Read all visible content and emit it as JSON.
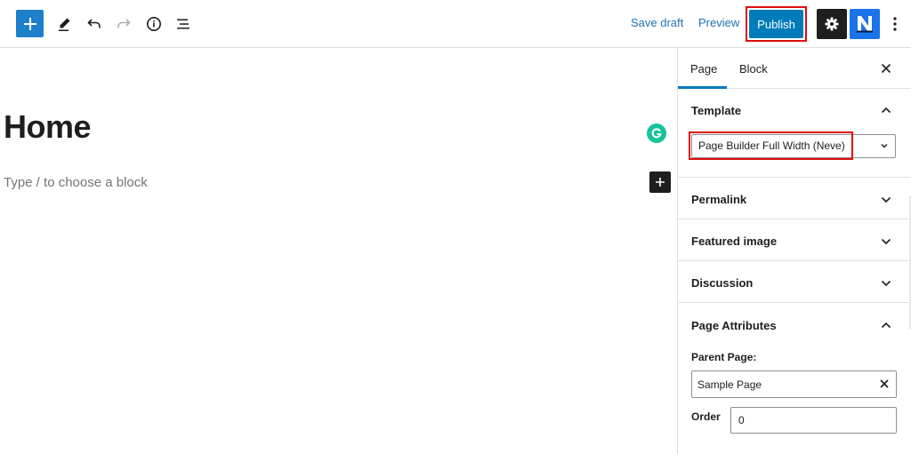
{
  "toolbar": {
    "save_draft_label": "Save draft",
    "preview_label": "Preview",
    "publish_label": "Publish",
    "neve_logo_text": "N"
  },
  "editor": {
    "title": "Home",
    "block_placeholder": "Type / to choose a block"
  },
  "sidebar": {
    "tabs": [
      {
        "label": "Page",
        "active": true
      },
      {
        "label": "Block",
        "active": false
      }
    ],
    "template": {
      "title": "Template",
      "selected": "Page Builder Full Width (Neve)",
      "expanded": true
    },
    "permalink": {
      "title": "Permalink",
      "expanded": false
    },
    "featured_image": {
      "title": "Featured image",
      "expanded": false
    },
    "discussion": {
      "title": "Discussion",
      "expanded": false
    },
    "page_attributes": {
      "title": "Page Attributes",
      "expanded": true,
      "parent_label": "Parent Page:",
      "parent_value": "Sample Page",
      "order_label": "Order",
      "order_value": "0"
    }
  },
  "colors": {
    "primary": "#007cba",
    "highlight": "#e00c0c",
    "dark": "#1e1e1e",
    "grammarly": "#15c39a"
  }
}
